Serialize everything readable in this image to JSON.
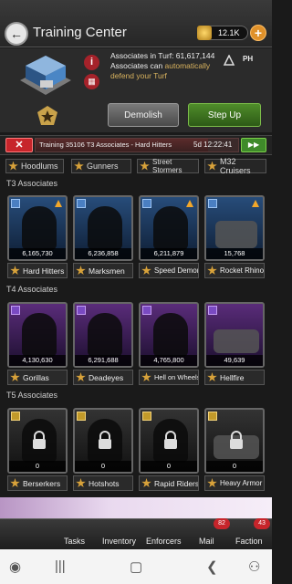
{
  "header": {
    "title": "Training Center",
    "gold": "12.1K"
  },
  "building": {
    "info_line1": "Associates in Turf: 61,617,144",
    "info_line2a": "Associates can ",
    "info_line2b": "automatically",
    "info_line3": "defend your Turf",
    "ph_label": "PH",
    "demolish_label": "Demolish",
    "stepup_label": "Step Up"
  },
  "training": {
    "label": "Training 35106 T3 Associates - Hard Hitters",
    "time": "5d 12:22:41",
    "progress": 0.85
  },
  "tabs": [
    "Hoodlums",
    "Gunners",
    "Street Stormers",
    "M32 Cruisers"
  ],
  "sections": {
    "t3": "T3 Associates",
    "t4": "T4 Associates",
    "t5": "T5 Associates"
  },
  "t3": [
    {
      "name": "Hard Hitters",
      "count": "6,165,730"
    },
    {
      "name": "Marksmen",
      "count": "6,236,858"
    },
    {
      "name": "Speed Demons",
      "count": "6,211,879"
    },
    {
      "name": "Rocket Rhinos",
      "count": "15,768"
    }
  ],
  "t4": [
    {
      "name": "Gorillas",
      "count": "4,130,630"
    },
    {
      "name": "Deadeyes",
      "count": "6,291,688"
    },
    {
      "name": "Hell on Wheels",
      "count": "4,765,800"
    },
    {
      "name": "Hellfire",
      "count": "49,639"
    }
  ],
  "t5": [
    {
      "name": "Berserkers",
      "count": "0"
    },
    {
      "name": "Hotshots",
      "count": "0"
    },
    {
      "name": "Rapid Riders",
      "count": "0"
    },
    {
      "name": "Heavy Armor",
      "count": "0"
    }
  ],
  "nav": {
    "tasks": "Tasks",
    "inventory": "Inventory",
    "enforcers": "Enforcers",
    "mail": "Mail",
    "mail_badge": "82",
    "faction": "Faction",
    "faction_badge": "43"
  },
  "icons": {
    "back": "back-arrow-icon",
    "gold": "gold-icon",
    "lock": "lock-icon"
  }
}
